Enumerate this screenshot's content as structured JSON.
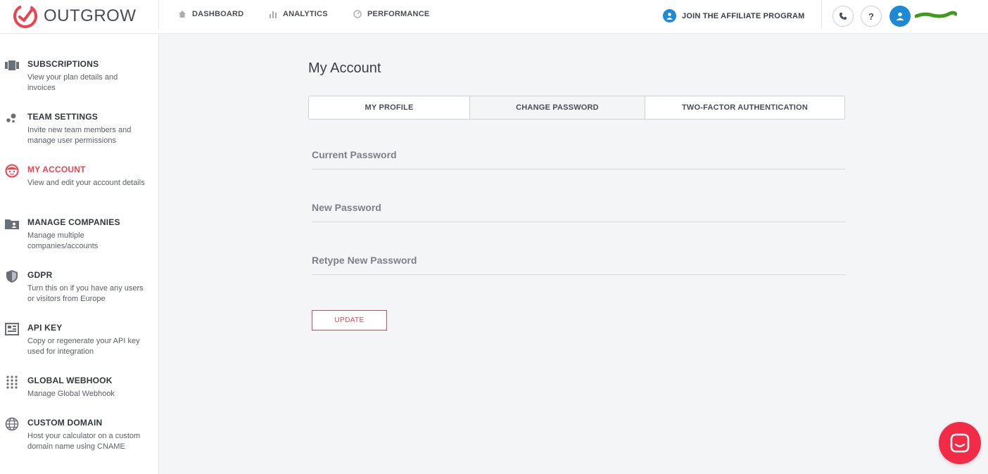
{
  "brand": {
    "name": "OUTGROW",
    "accent": "#f0424d",
    "blue": "#1c8ad4"
  },
  "nav": {
    "items": [
      {
        "label": "DASHBOARD",
        "icon": "home-icon"
      },
      {
        "label": "ANALYTICS",
        "icon": "bar-chart-icon"
      },
      {
        "label": "PERFORMANCE",
        "icon": "gauge-icon"
      }
    ],
    "affiliate_label": "JOIN THE AFFILIATE PROGRAM",
    "help_label": "?"
  },
  "sidebar": {
    "items": [
      {
        "title": "SUBSCRIPTIONS",
        "desc": "View your plan details and invoices",
        "icon": "subscriptions-icon"
      },
      {
        "title": "TEAM SETTINGS",
        "desc": "Invite new team members and manage user permissions",
        "icon": "team-icon"
      },
      {
        "title": "MY ACCOUNT",
        "desc": "View and edit your account details",
        "icon": "account-face-icon",
        "active": true
      },
      {
        "title": "MANAGE COMPANIES",
        "desc": "Manage multiple companies/accounts",
        "icon": "folder-user-icon"
      },
      {
        "title": "GDPR",
        "desc": "Turn this on if you have any users or visitors from Europe",
        "icon": "shield-icon"
      },
      {
        "title": "API KEY",
        "desc": "Copy or regenerate your API key used for integration",
        "icon": "api-key-icon"
      },
      {
        "title": "GLOBAL WEBHOOK",
        "desc": "Manage Global Webhook",
        "icon": "dots-grid-icon"
      },
      {
        "title": "CUSTOM DOMAIN",
        "desc": "Host your calculator on a custom domain name using CNAME",
        "icon": "globe-icon"
      }
    ]
  },
  "main": {
    "title": "My Account",
    "tabs": [
      {
        "label": "MY PROFILE"
      },
      {
        "label": "CHANGE PASSWORD",
        "active": true
      },
      {
        "label": "TWO-FACTOR AUTHENTICATION"
      }
    ],
    "fields": {
      "current": {
        "placeholder": "Current Password",
        "value": ""
      },
      "new": {
        "placeholder": "New Password",
        "value": ""
      },
      "retype": {
        "placeholder": "Retype New Password",
        "value": ""
      }
    },
    "update_label": "UPDATE"
  }
}
